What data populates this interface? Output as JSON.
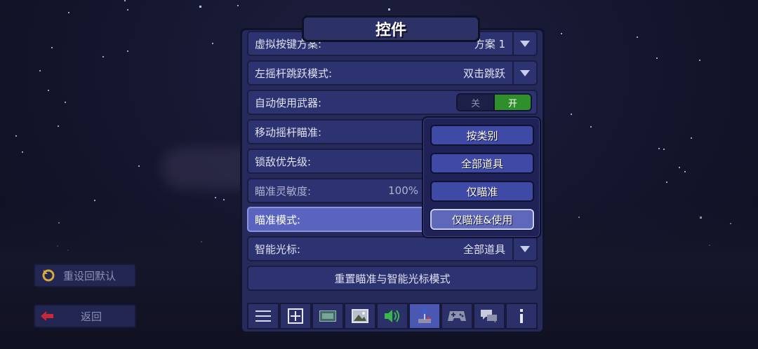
{
  "title": "控件",
  "settings": [
    {
      "label": "虚拟按键方案:",
      "value": "方案 1"
    },
    {
      "label": "左摇杆跳跃模式:",
      "value": "双击跳跃"
    },
    {
      "label": "自动使用武器:",
      "toggle_off": "关",
      "toggle_on": "开",
      "state": "on"
    },
    {
      "label": "移动摇杆瞄准:"
    },
    {
      "label": "锁敌优先级:"
    },
    {
      "label": "瞄准灵敏度:",
      "value": "100%"
    },
    {
      "label": "瞄准模式:"
    },
    {
      "label": "智能光标:",
      "value": "全部道具"
    }
  ],
  "reset_aim_button": "重置瞄准与智能光标模式",
  "dropdown": {
    "options": [
      "按类别",
      "全部道具",
      "仅瞄准",
      "仅瞄准&使用"
    ],
    "selected_index": 3
  },
  "side": {
    "reset_default": "重设回默认",
    "back": "返回"
  },
  "tabs": [
    {
      "icon": "menu-icon"
    },
    {
      "icon": "interface-icon"
    },
    {
      "icon": "video-icon"
    },
    {
      "icon": "picture-icon"
    },
    {
      "icon": "sound-icon"
    },
    {
      "icon": "joystick-icon",
      "active": true
    },
    {
      "icon": "gamepad-icon"
    },
    {
      "icon": "chat-icon"
    },
    {
      "icon": "info-icon"
    }
  ],
  "colors": {
    "panel": "#252a5a",
    "row": "#2d3370",
    "active_row": "#5a64bf",
    "toggle_on": "#2f8f2a",
    "dropdown_option": "#3e4aa6"
  }
}
